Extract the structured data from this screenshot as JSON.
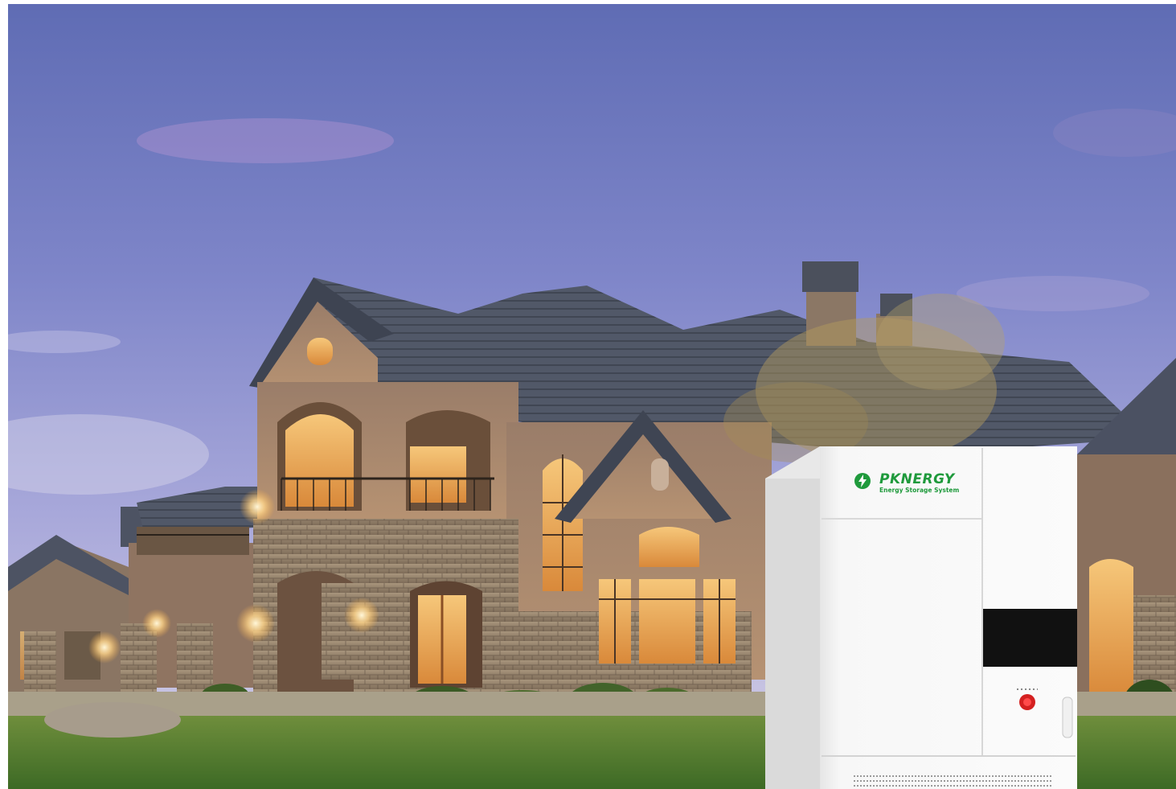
{
  "scene": {
    "description_free": true,
    "sky_colors": [
      "#6570b8",
      "#8a8fcf",
      "#b7b4de",
      "#d9d3e8"
    ],
    "house_wall": "#a98a70",
    "stone": "#9c8a74",
    "roof": "#4f5566",
    "window_glow": "#f2b15a",
    "lawn": "#4f7a2e"
  },
  "product": {
    "brand": "PKNERGY",
    "tagline": "Energy Storage System",
    "brand_color": "#1f9a3c",
    "body_color": "#f4f4f4",
    "display_color": "#111111",
    "button_color": "#d42020"
  },
  "icons": {
    "brand_logo": "lightning-circle-icon",
    "power_button": "power-button-icon",
    "handle": "door-handle-icon",
    "vent": "vent-grille-icon"
  }
}
